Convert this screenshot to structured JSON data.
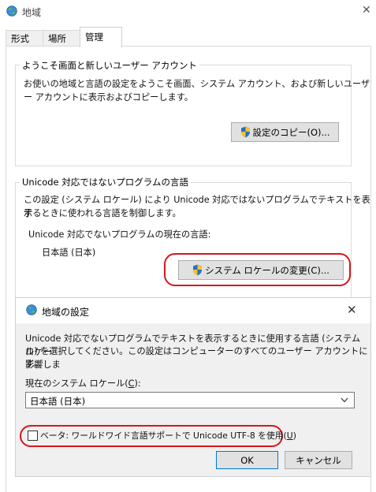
{
  "region": {
    "title": "地域",
    "close_glyph": "✕",
    "tabs": [
      {
        "label": "形式"
      },
      {
        "label": "場所"
      },
      {
        "label": "管理"
      }
    ],
    "welcome_group": {
      "title": "ようこそ画面と新しいユーザー アカウント",
      "description_line1": "お使いの地域と言語の設定をようこそ画面、システム アカウント、および新しいユーザ",
      "description_line2": "ー アカウントに表示およびコピーします。",
      "copy_button": "設定のコピー(O)..."
    },
    "non_unicode_group": {
      "title": "Unicode 対応ではないプログラムの言語",
      "description_line1": "この設定 (システム ロケール) により Unicode 対応ではないプログラムでテキストを表示",
      "description_line2": "するときに使われる言語を制御します。",
      "current_label": "Unicode 対応でないプログラムの現在の言語:",
      "current_value": "日本語 (日本)",
      "change_button": "システム ロケールの変更(C)..."
    }
  },
  "dialog": {
    "title": "地域の設定",
    "close_glyph": "✕",
    "description_line1": "Unicode 対応でないプログラムでテキストを表示するときに使用する言語 (システム ロケー",
    "description_line2": "ル) を選択してください。この設定はコンピューターのすべてのユーザー アカウントに影響しま",
    "description_line3": "す。",
    "locale_label_pre": "現在のシステム ロケール(",
    "locale_label_key": "C",
    "locale_label_post": "):",
    "locale_selected": "日本語 (日本)",
    "beta_checked": false,
    "beta_label_pre": "ベータ: ワールドワイド言語サポートで Unicode UTF-8 を使用(",
    "beta_label_key": "U",
    "beta_label_post": ")",
    "ok_button": "OK",
    "cancel_button": "キャンセル"
  },
  "colors": {
    "highlight_oval": "#d4191c",
    "button_face": "#e1e1e1",
    "dialog_background": "#f0f0f0"
  },
  "icons": {
    "window_icon": "globe-icon",
    "button_icon": "uac-shield-icon",
    "dropdown": "chevron-down-icon"
  }
}
